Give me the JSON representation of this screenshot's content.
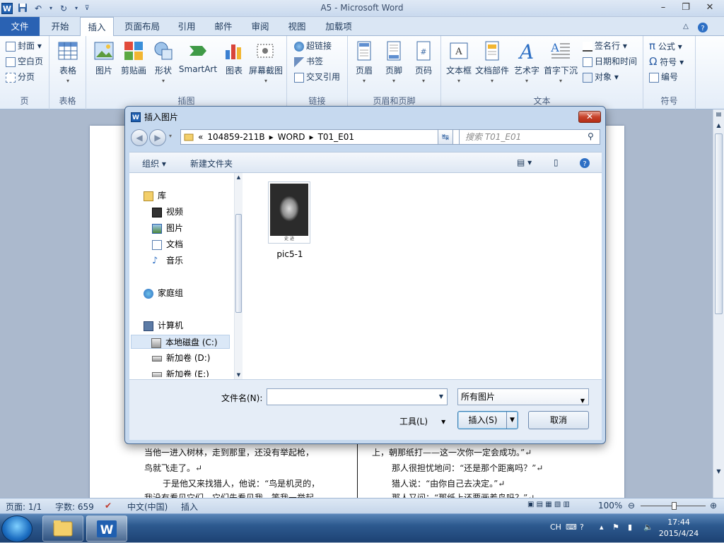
{
  "app": {
    "title": "A5 - Microsoft Word",
    "logo": "W",
    "window_controls": [
      "–",
      "❐",
      "✕"
    ]
  },
  "ribbon": {
    "tabs": [
      "文件",
      "开始",
      "插入",
      "页面布局",
      "引用",
      "邮件",
      "审阅",
      "视图",
      "加载项"
    ],
    "active_tab": "插入",
    "groups": {
      "pages": {
        "label": "页",
        "items": [
          "封面",
          "空白页",
          "分页"
        ]
      },
      "tables": {
        "label": "表格",
        "button": "表格"
      },
      "illustrations": {
        "label": "插图",
        "buttons": [
          "图片",
          "剪贴画",
          "形状",
          "SmartArt",
          "图表",
          "屏幕截图"
        ]
      },
      "links": {
        "label": "链接",
        "items": [
          "超链接",
          "书签",
          "交叉引用"
        ]
      },
      "header_footer": {
        "label": "页眉和页脚",
        "buttons": [
          "页眉",
          "页脚",
          "页码"
        ]
      },
      "text": {
        "label": "文本",
        "buttons": [
          "文本框",
          "文档部件",
          "艺术字",
          "首字下沉"
        ],
        "items": [
          "签名行",
          "日期和时间",
          "对象"
        ]
      },
      "symbols": {
        "label": "符号",
        "items": [
          "公式",
          "符号",
          "编号"
        ]
      }
    }
  },
  "document": {
    "left_col": [
      "当他一进入树林，走到那里，还没有举起枪，",
      "鸟就飞走了。↵",
      "于是他又来找猎人，他说：“鸟是机灵的，",
      "我没有看见它们，它们先看见我，等我一举起"
    ],
    "right_col": [
      "上，朝那纸打——这一次你一定会成功。”↵",
      "那人很担忧地问：“还是那个距离吗？”↵",
      "猎人说：“由你自己去决定。”↵",
      "那人又问：“那纸上还要画着鸟吗？”↵"
    ]
  },
  "dialog": {
    "title": "插入图片",
    "breadcrumb": [
      "«",
      "104859-211B",
      "▸",
      "WORD",
      "▸",
      "T01_E01"
    ],
    "search_placeholder": "搜索 T01_E01",
    "toolbar": {
      "organize": "组织 ▾",
      "new_folder": "新建文件夹"
    },
    "nav": {
      "library": "库",
      "video": "视频",
      "pictures": "图片",
      "documents": "文档",
      "music": "音乐",
      "homegroup": "家庭组",
      "computer": "计算机",
      "drive_c": "本地磁盘 (C:)",
      "drive_d": "新加卷 (D:)",
      "drive_e": "新加卷 (E:)"
    },
    "files": [
      {
        "name": "pic5-1",
        "caption": "史 迹"
      }
    ],
    "filename_label": "文件名(N):",
    "filename_value": "",
    "filetype": "所有图片",
    "tools": "工具(L)",
    "insert": "插入(S)",
    "cancel": "取消"
  },
  "status": {
    "page": "页面: 1/1",
    "words": "字数: 659",
    "lang": "中文(中国)",
    "mode": "插入",
    "zoom": "100%"
  },
  "taskbar": {
    "ime": "CH",
    "time": "17:44",
    "date": "2015/4/24"
  }
}
